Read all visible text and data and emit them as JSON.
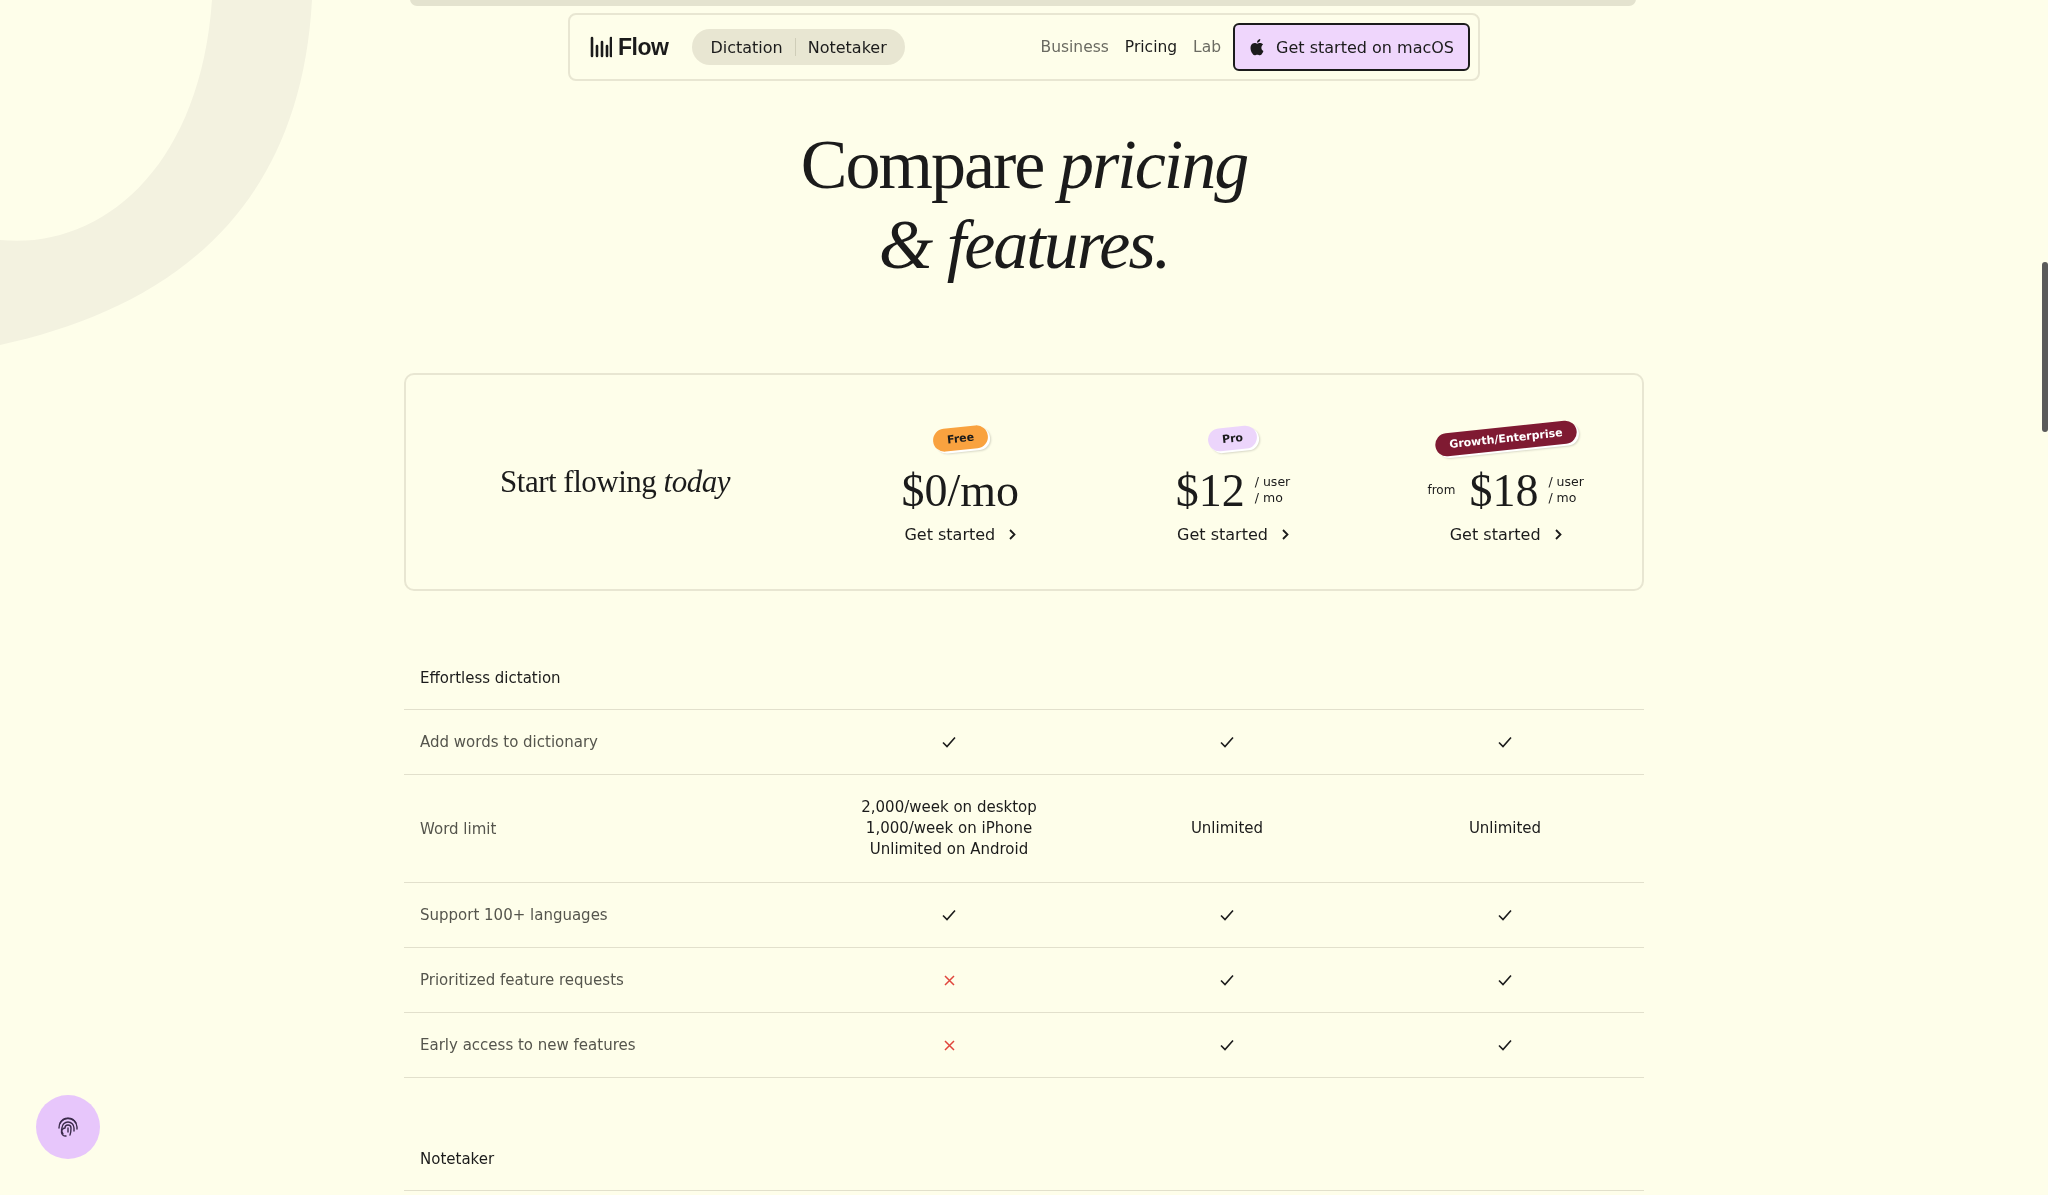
{
  "nav": {
    "logo": "Flow",
    "toggle": [
      {
        "label": "Dictation"
      },
      {
        "label": "Notetaker"
      }
    ],
    "links": [
      {
        "label": "Business",
        "selected": false
      },
      {
        "label": "Pricing",
        "selected": true
      },
      {
        "label": "Lab",
        "selected": false
      }
    ],
    "cta": "Get started on macOS"
  },
  "heading": {
    "line1": "Compare *pricing*",
    "line2": "*& features.*"
  },
  "plans_card": {
    "tagline": "Start flowing *today*",
    "plans": [
      {
        "badge": "Free",
        "color": "#f9a23f",
        "price": "$0/mo",
        "cta": "Get started"
      },
      {
        "badge": "Pro",
        "color": "#ecd5fb",
        "price": "$12",
        "unit": [
          "/ user",
          "/ mo"
        ],
        "cta": "Get started"
      },
      {
        "badge": "Growth/Enterprise",
        "color": "#7f1a32",
        "from": "from",
        "price": "$18",
        "unit": [
          "/ user",
          "/ mo"
        ],
        "cta": "Get started"
      }
    ]
  },
  "sections": [
    {
      "title": "Effortless dictation",
      "rows": [
        {
          "label": "Add words to dictionary",
          "cells": [
            {
              "kind": "check"
            },
            {
              "kind": "check"
            },
            {
              "kind": "check"
            }
          ]
        },
        {
          "label": "Word limit",
          "cells": [
            {
              "kind": "text",
              "lines": [
                "2,000/week on desktop",
                "1,000/week on iPhone",
                "Unlimited on Android"
              ]
            },
            {
              "kind": "text",
              "lines": [
                "Unlimited"
              ]
            },
            {
              "kind": "text",
              "lines": [
                "Unlimited"
              ]
            }
          ]
        },
        {
          "label": "Support 100+ languages",
          "cells": [
            {
              "kind": "check"
            },
            {
              "kind": "check"
            },
            {
              "kind": "check"
            }
          ]
        },
        {
          "label": "Prioritized feature requests",
          "cells": [
            {
              "kind": "cross"
            },
            {
              "kind": "check"
            },
            {
              "kind": "check"
            }
          ]
        },
        {
          "label": "Early access to new features",
          "cells": [
            {
              "kind": "cross"
            },
            {
              "kind": "check"
            },
            {
              "kind": "check"
            }
          ]
        }
      ]
    },
    {
      "title": "Notetaker"
    }
  ]
}
